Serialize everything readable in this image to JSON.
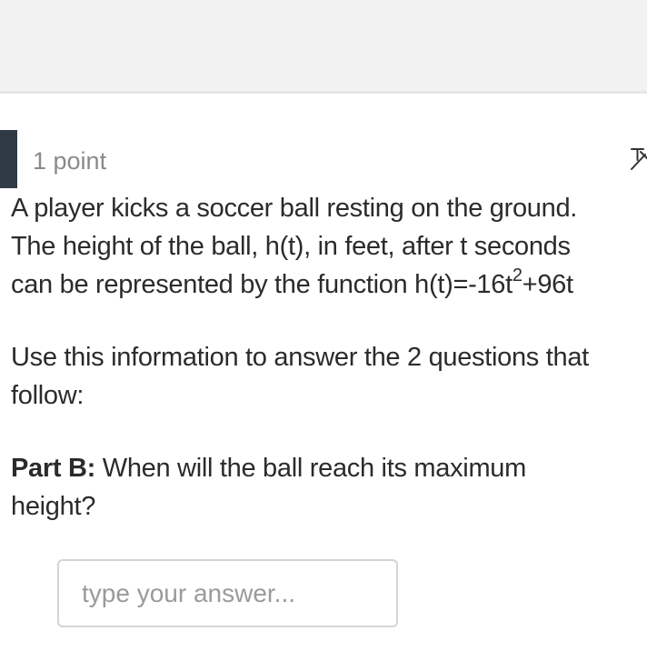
{
  "question": {
    "points": "1 point",
    "stem": {
      "line1": "A player kicks a soccer ball resting on the ground.",
      "line2": "The height of the ball, h(t), in feet, after t seconds",
      "line3_prefix": "can be represented by the function h(t)=-16t",
      "line3_exponent": "2",
      "line3_suffix": "+96t"
    },
    "instruction": {
      "line1": "Use this information to answer the 2 questions that",
      "line2": "follow:"
    },
    "part": {
      "label": "Part B:",
      "text_line1": " When will the ball reach its maximum",
      "text_line2": "height?"
    },
    "answer": {
      "placeholder": "type your answer...",
      "value": ""
    },
    "icons": {
      "pin": "pin-icon"
    }
  }
}
